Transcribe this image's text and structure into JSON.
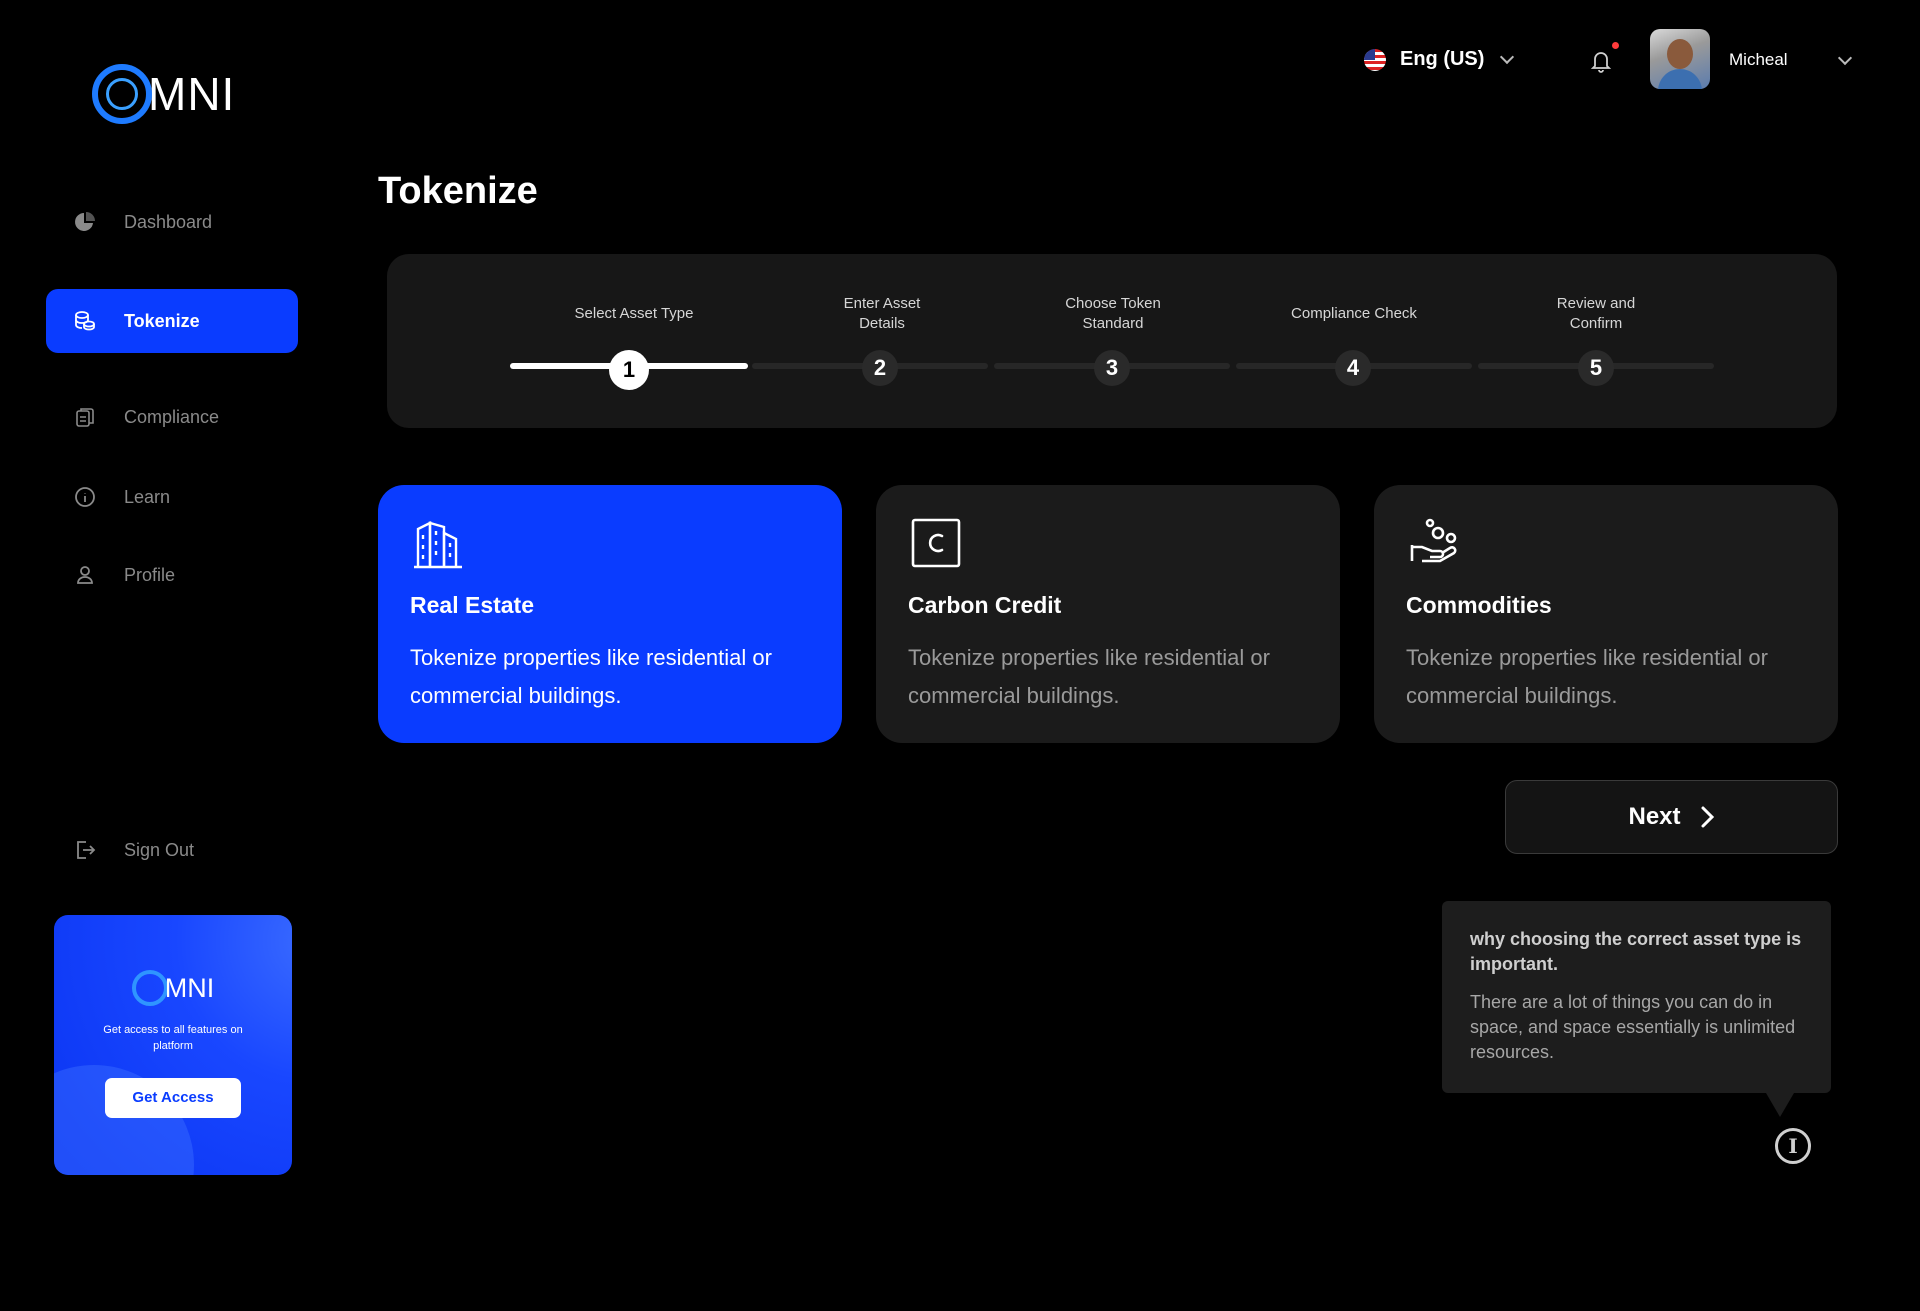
{
  "brand": {
    "logo_text": "MNI"
  },
  "sidebar": {
    "items": [
      {
        "label": "Dashboard",
        "icon": "pie-chart-icon"
      },
      {
        "label": "Tokenize",
        "icon": "coins-icon",
        "active": true
      },
      {
        "label": "Compliance",
        "icon": "clipboard-icon"
      },
      {
        "label": "Learn",
        "icon": "info-icon"
      },
      {
        "label": "Profile",
        "icon": "user-icon"
      }
    ],
    "signout": {
      "label": "Sign Out",
      "icon": "sign-out-icon"
    }
  },
  "promo": {
    "logo_text": "MNI",
    "text": "Get access to all features on platform",
    "button": "Get Access"
  },
  "header": {
    "language": "Eng (US)",
    "user_name": "Micheal"
  },
  "page": {
    "title": "Tokenize"
  },
  "stepper": {
    "current": 1,
    "steps": [
      {
        "number": "1",
        "label": "Select Asset Type"
      },
      {
        "number": "2",
        "label": "Enter Asset Details"
      },
      {
        "number": "3",
        "label": "Choose Token Standard"
      },
      {
        "number": "4",
        "label": "Compliance Check"
      },
      {
        "number": "5",
        "label": "Review and Confirm"
      }
    ]
  },
  "assets": [
    {
      "title": "Real Estate",
      "description": "Tokenize properties like residential or commercial buildings.",
      "icon": "building-icon",
      "selected": true
    },
    {
      "title": "Carbon Credit",
      "description": "Tokenize properties like residential or commercial buildings.",
      "icon": "carbon-c-icon",
      "selected": false
    },
    {
      "title": "Commodities",
      "description": "Tokenize properties like residential or commercial buildings.",
      "icon": "hand-coins-icon",
      "selected": false
    }
  ],
  "next_button": "Next",
  "tooltip": {
    "title": "why choosing the correct asset type is important.",
    "body": "There are a lot of things you can do in space, and space essentially is unlimited resources."
  },
  "colors": {
    "accent": "#0a3cff",
    "background": "#000000",
    "card": "#1b1b1b"
  }
}
